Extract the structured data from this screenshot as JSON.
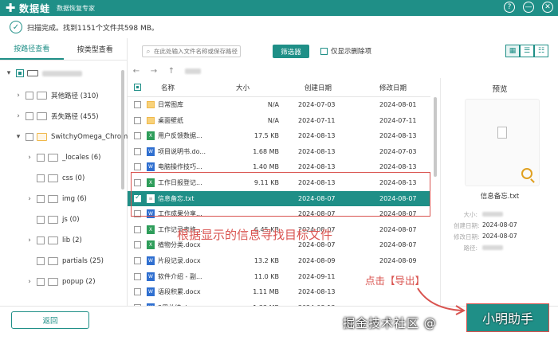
{
  "app": {
    "name": "数据蛙",
    "subtitle": "数据恢复专家",
    "logo_glyph": "✚"
  },
  "window_controls": [
    "?",
    "—",
    "✕"
  ],
  "status": {
    "text": "扫描完成。找到1151个文件共598 MB。"
  },
  "left_tabs": [
    {
      "label": "按路径查看",
      "active": true
    },
    {
      "label": "按类型查看",
      "active": false
    }
  ],
  "tree": [
    {
      "label": "",
      "count": "",
      "icon": "drive-icon",
      "toggle": "▾"
    },
    {
      "label": "其他路径 (310)",
      "icon": "folder-icon",
      "toggle": "›"
    },
    {
      "label": "丢失路径 (455)",
      "icon": "folder-icon",
      "toggle": "›"
    },
    {
      "label": "SwitchyOmega_Chrom",
      "icon": "folder-icon",
      "toggle": "▾"
    },
    {
      "label": "_locales (6)",
      "icon": "folder-icon",
      "toggle": "›"
    },
    {
      "label": "css (0)",
      "icon": "folder-icon",
      "toggle": ""
    },
    {
      "label": "img (6)",
      "icon": "folder-icon",
      "toggle": "›"
    },
    {
      "label": "js (0)",
      "icon": "folder-icon",
      "toggle": ""
    },
    {
      "label": "lib (2)",
      "icon": "folder-icon",
      "toggle": "›"
    },
    {
      "label": "partials (25)",
      "icon": "folder-icon",
      "toggle": ""
    },
    {
      "label": "popup (2)",
      "icon": "folder-icon",
      "toggle": "›"
    }
  ],
  "back_label": "返回",
  "toolbar": {
    "search_placeholder": "在此处输入文件名称或保存路径",
    "filter_label": "筛选器",
    "only_deleted_label": "仅显示删除项",
    "view_icons": [
      "▦",
      "☰",
      "☷"
    ]
  },
  "nav": {
    "back": "←",
    "forward": "→",
    "up": "↑"
  },
  "table": {
    "headers": {
      "name": "名称",
      "size": "大小",
      "created": "创建日期",
      "modified": "修改日期"
    },
    "rows": [
      {
        "icon": "folder",
        "name": "日常图库",
        "size": "N/A",
        "created": "2024-07-03",
        "modified": "2024-08-01",
        "selected": false
      },
      {
        "icon": "folder",
        "name": "桌面壁纸",
        "size": "N/A",
        "created": "2024-07-11",
        "modified": "2024-07-11",
        "selected": false
      },
      {
        "icon": "xls",
        "name": "用户反馈数据...",
        "size": "17.5 KB",
        "created": "2024-08-13",
        "modified": "2024-08-13",
        "selected": false
      },
      {
        "icon": "doc",
        "name": "项目说明书.do...",
        "size": "1.68 MB",
        "created": "2024-08-13",
        "modified": "2024-07-03",
        "selected": false
      },
      {
        "icon": "doc",
        "name": "电脑操作技巧...",
        "size": "1.40 MB",
        "created": "2024-08-13",
        "modified": "2024-08-13",
        "selected": false
      },
      {
        "icon": "xls",
        "name": "工作日报登记...",
        "size": "9.11 KB",
        "created": "2024-08-13",
        "modified": "2024-08-13",
        "selected": false
      },
      {
        "icon": "txt",
        "name": "信息备忘.txt",
        "size": "",
        "created": "2024-08-07",
        "modified": "2024-08-07",
        "selected": true
      },
      {
        "icon": "doc",
        "name": "工作成果分享...",
        "size": "",
        "created": "2024-08-07",
        "modified": "2024-08-07",
        "selected": false
      },
      {
        "icon": "xls",
        "name": "工作记录表格...",
        "size": "6.45 KB",
        "created": "2024-08-07",
        "modified": "2024-08-07",
        "selected": false
      },
      {
        "icon": "xls",
        "name": "植物分类.docx",
        "size": "",
        "created": "2024-08-07",
        "modified": "2024-08-07",
        "selected": false
      },
      {
        "icon": "doc",
        "name": "片段记录.docx",
        "size": "13.2 KB",
        "created": "2024-08-09",
        "modified": "2024-08-09",
        "selected": false
      },
      {
        "icon": "doc",
        "name": "软件介绍 - 副...",
        "size": "11.0 KB",
        "created": "2024-09-11",
        "modified": "",
        "selected": false
      },
      {
        "icon": "doc",
        "name": "语段积累.docx",
        "size": "1.11 MB",
        "created": "2024-08-13",
        "modified": "",
        "selected": false
      },
      {
        "icon": "doc",
        "name": "3周总结.docx",
        "size": "1.33 MB",
        "created": "2024-08-13",
        "modified": "",
        "selected": false
      }
    ]
  },
  "preview": {
    "title": "预览",
    "filename": "信息备忘.txt",
    "props": [
      {
        "key": "大小:",
        "value": ""
      },
      {
        "key": "创建日期:",
        "value": "2024-08-07"
      },
      {
        "key": "修改日期:",
        "value": "2024-08-07"
      },
      {
        "key": "路径:",
        "value": ""
      }
    ]
  },
  "annotations": {
    "main": "根据显示的信息寻找目标文件",
    "export_hint": "点击【导出】",
    "watermark": "掘金技术社区 @"
  },
  "export_label": "小明助手",
  "colors": {
    "accent": "#1f8f87",
    "annotation": "#d9534f"
  }
}
